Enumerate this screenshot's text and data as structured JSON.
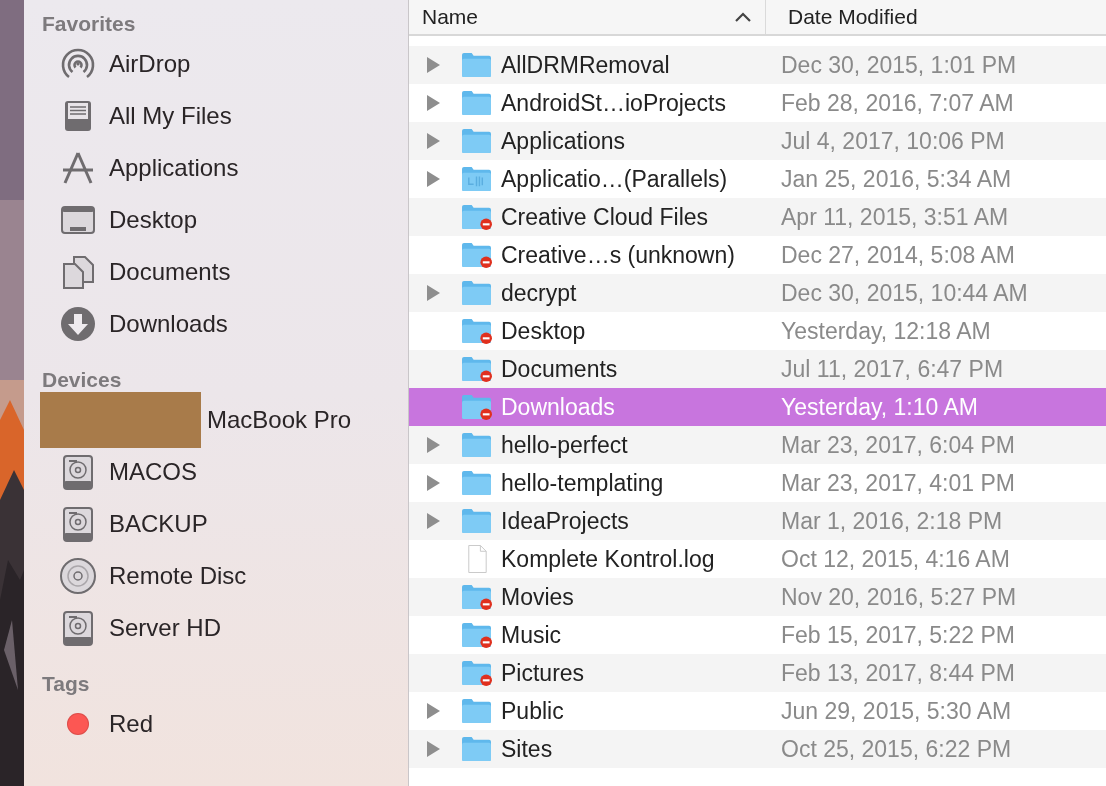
{
  "sidebar": {
    "sections": [
      {
        "title": "Favorites",
        "items": [
          {
            "kind": "airdrop",
            "label": "AirDrop"
          },
          {
            "kind": "files",
            "label": "All My Files"
          },
          {
            "kind": "apps",
            "label": "Applications"
          },
          {
            "kind": "desktop",
            "label": "Desktop"
          },
          {
            "kind": "documents",
            "label": "Documents"
          },
          {
            "kind": "downloads",
            "label": "Downloads"
          }
        ]
      },
      {
        "title": "Devices",
        "items": [
          {
            "kind": "redacted",
            "label": "MacBook Pro"
          },
          {
            "kind": "disk",
            "label": "MACOS"
          },
          {
            "kind": "disk",
            "label": "BACKUP"
          },
          {
            "kind": "disc",
            "label": "Remote Disc"
          },
          {
            "kind": "disk",
            "label": "Server HD"
          }
        ]
      },
      {
        "title": "Tags",
        "items": [
          {
            "kind": "tag",
            "label": "Red",
            "color": "#fc5753"
          }
        ]
      }
    ]
  },
  "table": {
    "columns": [
      {
        "label": "Name",
        "sorted": true
      },
      {
        "label": "Date Modified",
        "sorted": false
      }
    ],
    "rows": [
      {
        "name": "AllDRMRemoval",
        "date": "Dec 30, 2015, 1:01 PM",
        "kind": "folder",
        "expandable": true,
        "locked": false,
        "selected": false
      },
      {
        "name": "AndroidSt…ioProjects",
        "date": "Feb 28, 2016, 7:07 AM",
        "kind": "folder",
        "expandable": true,
        "locked": false,
        "selected": false
      },
      {
        "name": "Applications",
        "date": "Jul 4, 2017, 10:06 PM",
        "kind": "folder",
        "expandable": true,
        "locked": false,
        "selected": false
      },
      {
        "name": "Applicatio…(Parallels)",
        "date": "Jan 25, 2016, 5:34 AM",
        "kind": "app-folder",
        "expandable": true,
        "locked": false,
        "selected": false
      },
      {
        "name": "Creative Cloud Files",
        "date": "Apr 11, 2015, 3:51 AM",
        "kind": "folder",
        "expandable": false,
        "locked": true,
        "selected": false
      },
      {
        "name": "Creative…s (unknown)",
        "date": "Dec 27, 2014, 5:08 AM",
        "kind": "folder",
        "expandable": false,
        "locked": true,
        "selected": false
      },
      {
        "name": "decrypt",
        "date": "Dec 30, 2015, 10:44 AM",
        "kind": "folder",
        "expandable": true,
        "locked": false,
        "selected": false
      },
      {
        "name": "Desktop",
        "date": "Yesterday, 12:18 AM",
        "kind": "folder",
        "expandable": false,
        "locked": true,
        "selected": false
      },
      {
        "name": "Documents",
        "date": "Jul 11, 2017, 6:47 PM",
        "kind": "folder",
        "expandable": false,
        "locked": true,
        "selected": false
      },
      {
        "name": "Downloads",
        "date": "Yesterday, 1:10 AM",
        "kind": "folder",
        "expandable": false,
        "locked": true,
        "selected": true
      },
      {
        "name": "hello-perfect",
        "date": "Mar 23, 2017, 6:04 PM",
        "kind": "folder",
        "expandable": true,
        "locked": false,
        "selected": false
      },
      {
        "name": "hello-templating",
        "date": "Mar 23, 2017, 4:01 PM",
        "kind": "folder",
        "expandable": true,
        "locked": false,
        "selected": false
      },
      {
        "name": "IdeaProjects",
        "date": "Mar 1, 2016, 2:18 PM",
        "kind": "folder",
        "expandable": true,
        "locked": false,
        "selected": false
      },
      {
        "name": "Komplete Kontrol.log",
        "date": "Oct 12, 2015, 4:16 AM",
        "kind": "file",
        "expandable": false,
        "locked": false,
        "selected": false
      },
      {
        "name": "Movies",
        "date": "Nov 20, 2016, 5:27 PM",
        "kind": "folder",
        "expandable": false,
        "locked": true,
        "selected": false
      },
      {
        "name": "Music",
        "date": "Feb 15, 2017, 5:22 PM",
        "kind": "folder",
        "expandable": false,
        "locked": true,
        "selected": false
      },
      {
        "name": "Pictures",
        "date": "Feb 13, 2017, 8:44 PM",
        "kind": "folder",
        "expandable": false,
        "locked": true,
        "selected": false
      },
      {
        "name": "Public",
        "date": "Jun 29, 2015, 5:30 AM",
        "kind": "folder",
        "expandable": true,
        "locked": false,
        "selected": false
      },
      {
        "name": "Sites",
        "date": "Oct 25, 2015, 6:22 PM",
        "kind": "folder",
        "expandable": true,
        "locked": false,
        "selected": false
      }
    ]
  }
}
